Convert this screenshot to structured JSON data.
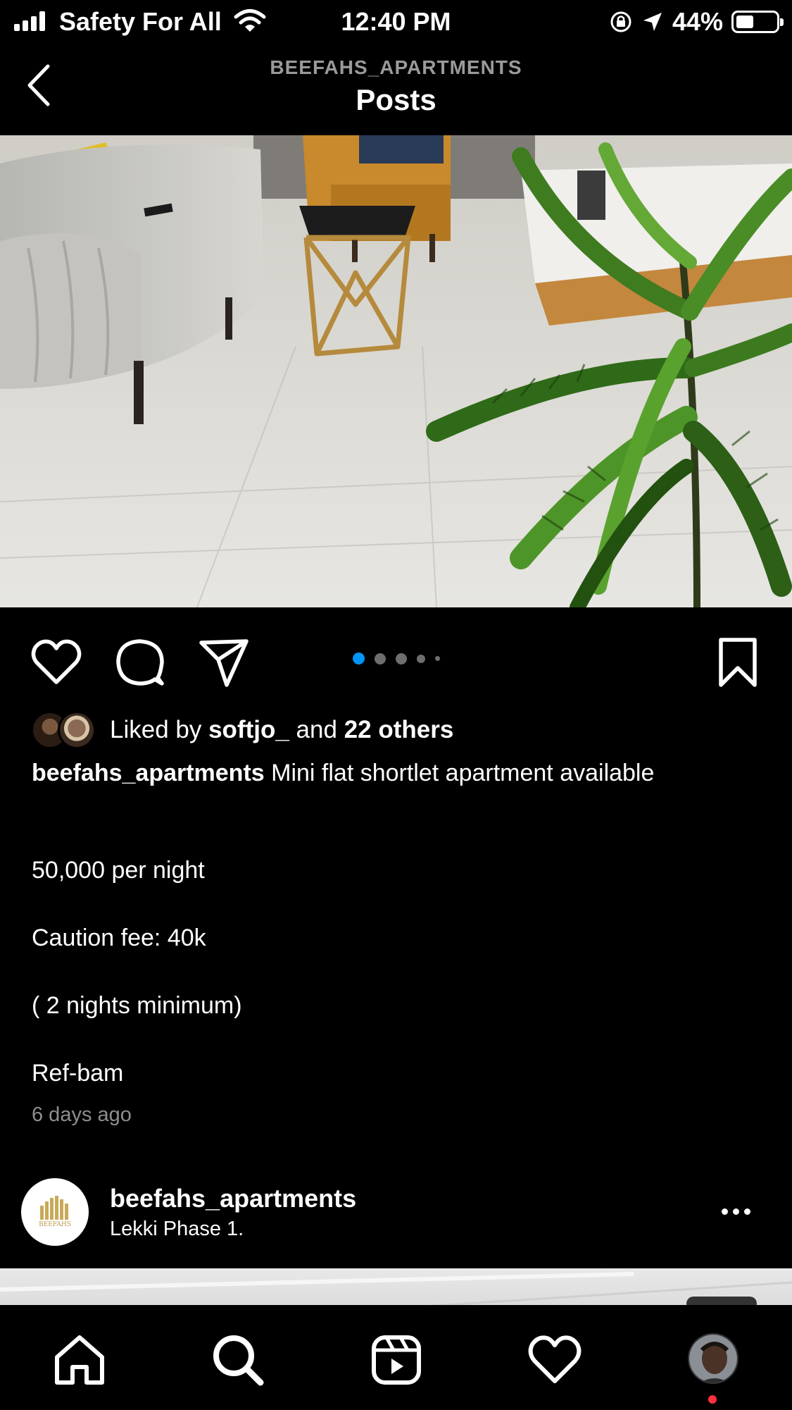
{
  "status_bar": {
    "carrier": "Safety For All",
    "time": "12:40 PM",
    "battery_percent": "44%",
    "battery_level": 0.44
  },
  "header": {
    "account": "BEEFAHS_APARTMENTS",
    "title": "Posts"
  },
  "post": {
    "carousel": {
      "total": 5,
      "active_index": 0,
      "active_color": "#0095f6"
    },
    "likes": {
      "prefix": "Liked by ",
      "user": "softjo_",
      "middle": " and ",
      "others": "22 others"
    },
    "caption": {
      "user": "beefahs_apartments",
      "text": " Mini flat shortlet apartment available",
      "lines": [
        "50,000 per night",
        "Caution fee: 40k",
        "( 2 nights minimum)",
        "Ref-bam"
      ]
    },
    "timestamp": "6 days ago"
  },
  "next_post": {
    "username": "beefahs_apartments",
    "location": "Lekki Phase 1.",
    "avatar_logo_text": "BEEFAHS"
  },
  "tab_bar": {
    "icons": [
      "home-icon",
      "search-icon",
      "reels-icon",
      "heart-icon",
      "profile-avatar"
    ],
    "notification_color": "#ff3040"
  }
}
